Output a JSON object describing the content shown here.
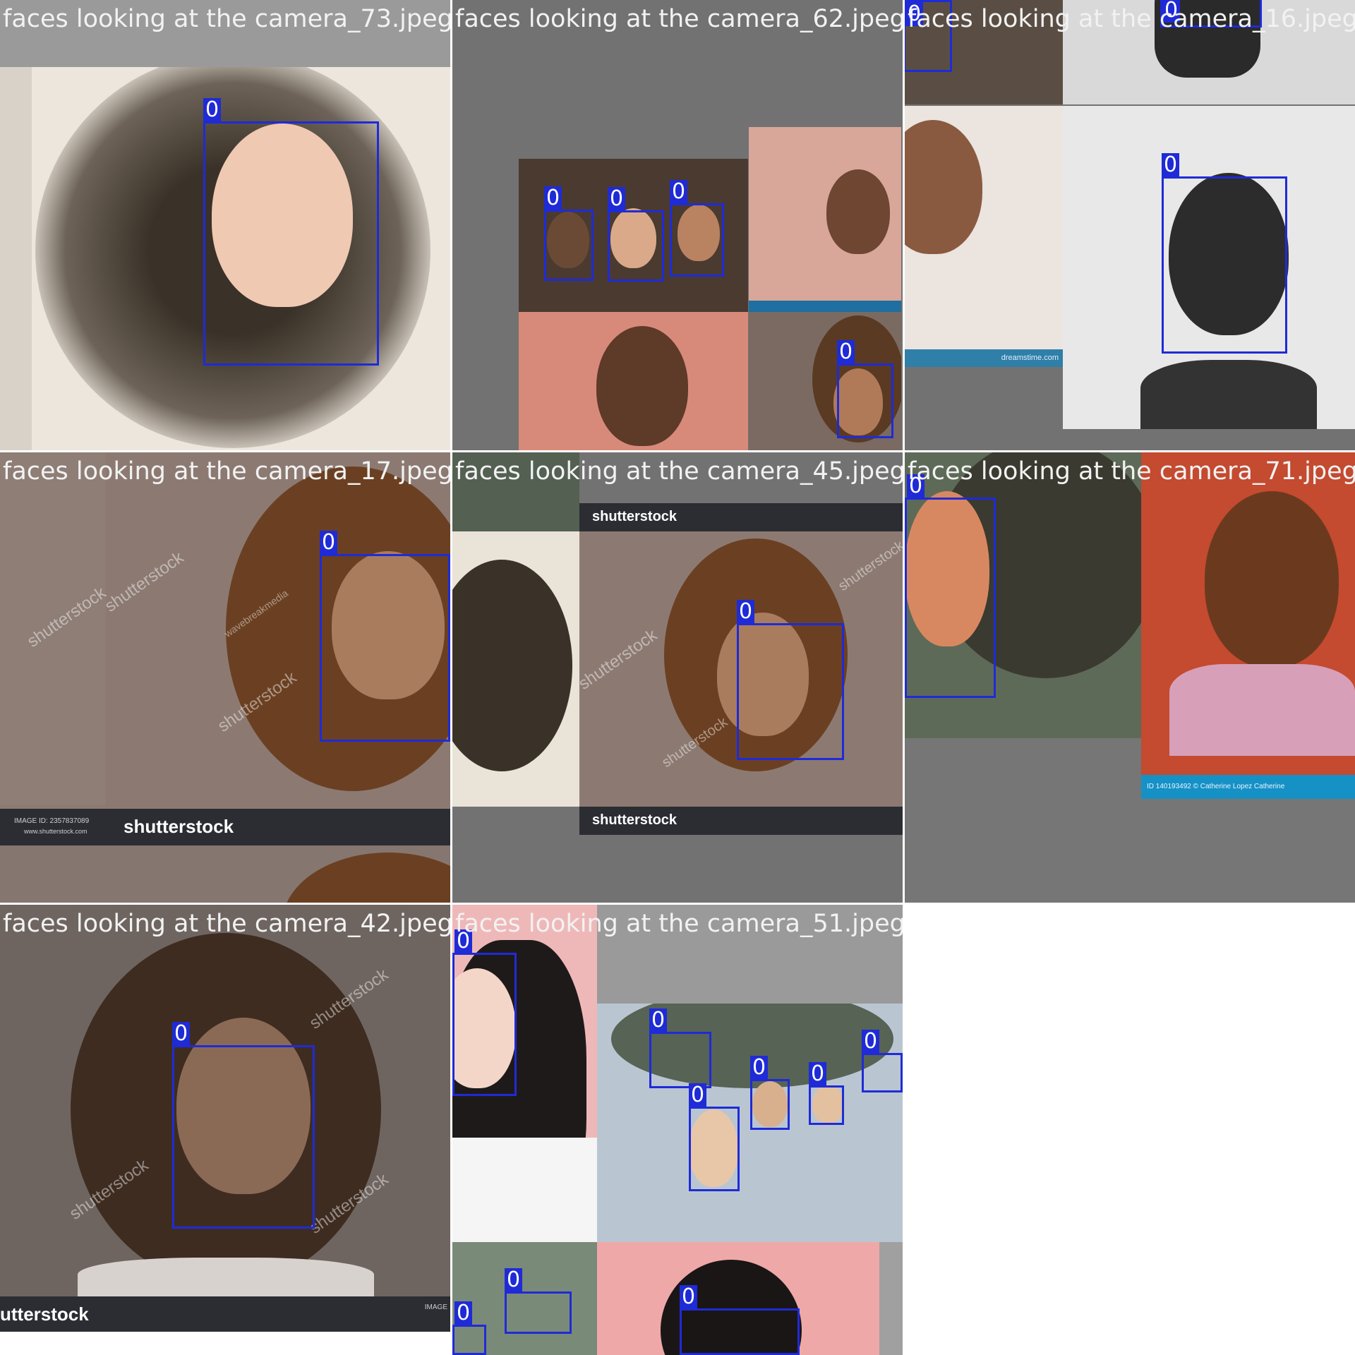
{
  "mosaic": {
    "tiles": [
      {
        "title": "faces looking at the camera_73.jpeg",
        "labels": [
          "0"
        ]
      },
      {
        "title": "faces looking at the camera_62.jpeg",
        "labels": [
          "0",
          "0",
          "0",
          "0"
        ]
      },
      {
        "title": "faces looking at the camera_16.jpeg",
        "labels": [
          "0",
          "0",
          "0"
        ]
      },
      {
        "title": "faces looking at the camera_17.jpeg",
        "labels": [
          "0"
        ],
        "bar_text": "shutterstock",
        "bar_small": "IMAGE ID: 2357837089",
        "bar_url": "www.shutterstock.com"
      },
      {
        "title": "faces looking at the camera_45.jpeg",
        "labels": [
          "0"
        ],
        "bar_text": "shutterstock",
        "bar_text2": "shutterstock"
      },
      {
        "title": "faces looking at the camera_71.jpeg",
        "labels": [
          "0"
        ],
        "bar_text": "ID 140193492 © Catherine Lopez Catherine"
      },
      {
        "title": "faces looking at the camera_42.jpeg",
        "labels": [
          "0"
        ],
        "bar_text": "utterstock",
        "bar_small": "IMAGE"
      },
      {
        "title": "faces looking at the camera_51.jpeg",
        "labels": [
          "0",
          "0",
          "0",
          "0",
          "0",
          "0",
          "0",
          "0",
          "0"
        ]
      }
    ],
    "watermarks": {
      "shutterstock": "shutterstock",
      "wave": "wavebreakmedia",
      "dreamstime": "dreamstime.com"
    },
    "colors": {
      "bbox": "#1f2bd6",
      "background": "#727272"
    }
  }
}
